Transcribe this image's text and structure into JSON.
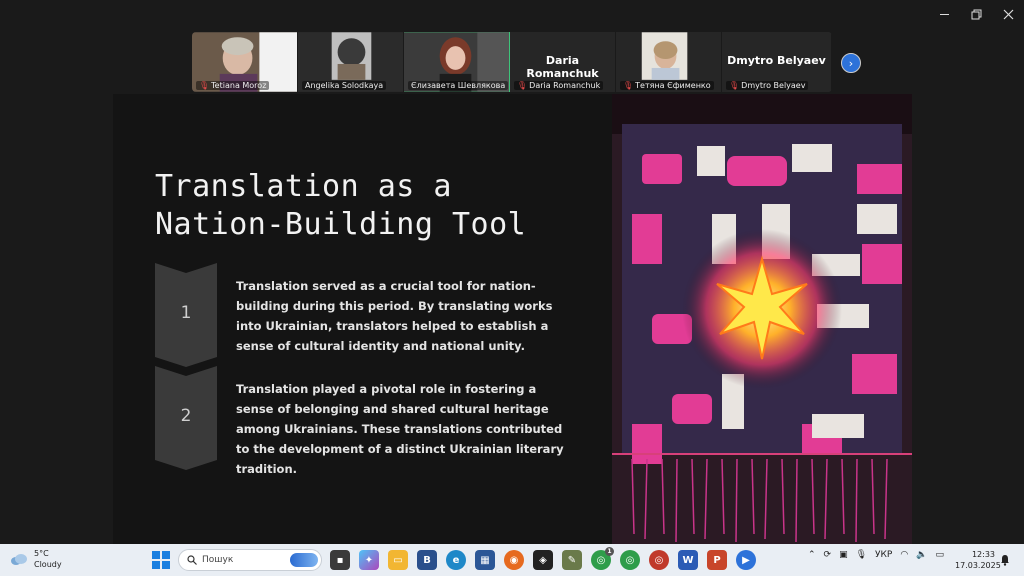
{
  "window": {
    "minimize": "—",
    "restore": "❐",
    "close": "✕"
  },
  "participants": [
    {
      "name": "Tetiana Moroz",
      "muted": true,
      "video": true
    },
    {
      "name": "Angelika Solodkaya",
      "muted": false,
      "video": true
    },
    {
      "name": "Єлизавета Шевлякова",
      "muted": false,
      "video": true,
      "active": true
    },
    {
      "name": "Daria Romanchuk",
      "muted": true,
      "video": false
    },
    {
      "name": "Тетяна Єфименко",
      "muted": true,
      "video": true
    },
    {
      "name": "Dmytro Belyaev",
      "muted": true,
      "video": false
    }
  ],
  "slide": {
    "title_line1": "Translation as a",
    "title_line2": "Nation-Building Tool",
    "steps": [
      {
        "number": "1",
        "text": "Translation served as a crucial tool for nation-building during this period. By translating works into Ukrainian, translators helped to establish a sense of cultural identity and national unity."
      },
      {
        "number": "2",
        "text": "Translation played a pivotal role in fostering a sense of belonging and shared cultural heritage among Ukrainians. These translations contributed to the development of a distinct Ukrainian literary tradition."
      }
    ]
  },
  "taskbar": {
    "weather_temp": "5°C",
    "weather_desc": "Cloudy",
    "search_placeholder": "Пошук",
    "language": "УКР",
    "time": "12:33",
    "date": "17.03.2025",
    "badge_count": "1"
  },
  "colors": {
    "active_tile": "#3ec47a",
    "accent_blue": "#2d72d9",
    "slide_bg": "#141414"
  }
}
